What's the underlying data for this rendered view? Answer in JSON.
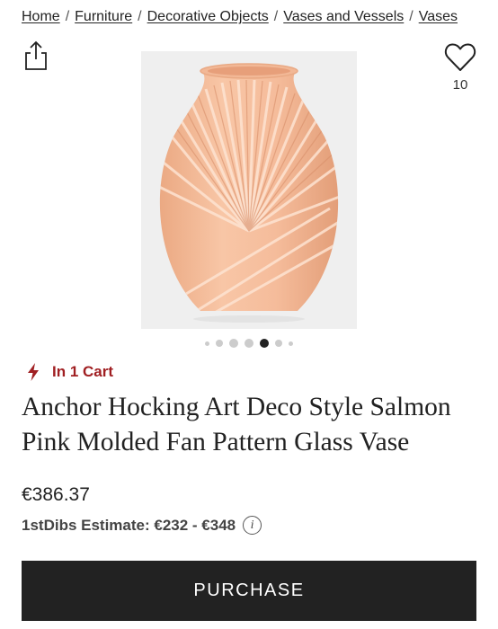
{
  "breadcrumb": [
    {
      "label": "Home"
    },
    {
      "label": "Furniture"
    },
    {
      "label": "Decorative Objects"
    },
    {
      "label": "Vases and Vessels"
    },
    {
      "label": "Vases"
    }
  ],
  "actions": {
    "share_icon": "share-icon",
    "favorite_icon": "heart-icon",
    "favorite_count": "10"
  },
  "gallery": {
    "total_images": 7,
    "active_index": 4
  },
  "cart_status": {
    "icon": "lightning-bolt-icon",
    "text": "In 1 Cart",
    "color": "#a01f22"
  },
  "product": {
    "title": "Anchor Hocking Art Deco Style Salmon Pink Molded Fan Pattern Glass Vase",
    "price": "€386.37",
    "estimate": "1stDibs Estimate: €232 - €348",
    "estimate_info_icon": "info-icon"
  },
  "purchase_button": {
    "label": "PURCHASE",
    "background": "#222222"
  }
}
